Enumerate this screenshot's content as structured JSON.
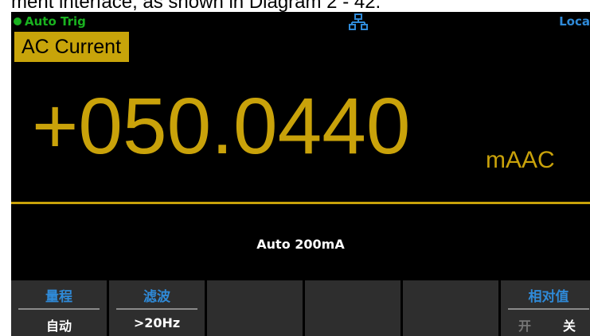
{
  "caption": "ment interface, as shown in Diagram 2 - 42.",
  "status": {
    "trigger": "Auto  Trig",
    "remote": "Loca",
    "icon": "network-lan-icon",
    "colors": {
      "trigger": "#19b21f",
      "remote": "#2f8ad8",
      "icon": "#2f8ad8"
    }
  },
  "measurement": {
    "function": "AC Current",
    "value": "+050.0440",
    "unit": "mAAC",
    "range_info": "Auto 200mA",
    "colors": {
      "reading": "#c9a20a",
      "function_bg": "#c8a40a"
    }
  },
  "softkeys": [
    {
      "title": "量程",
      "value": "自动"
    },
    {
      "title": "滤波",
      "value": ">20Hz"
    },
    {
      "title": "",
      "value": ""
    },
    {
      "title": "",
      "value": ""
    },
    {
      "title": "",
      "value": ""
    },
    {
      "title": "相对值",
      "options": [
        "开",
        "关"
      ],
      "selected": "关"
    }
  ],
  "softkey_colors": {
    "title": "#2f8ad8",
    "bg": "#2e2e2e"
  }
}
